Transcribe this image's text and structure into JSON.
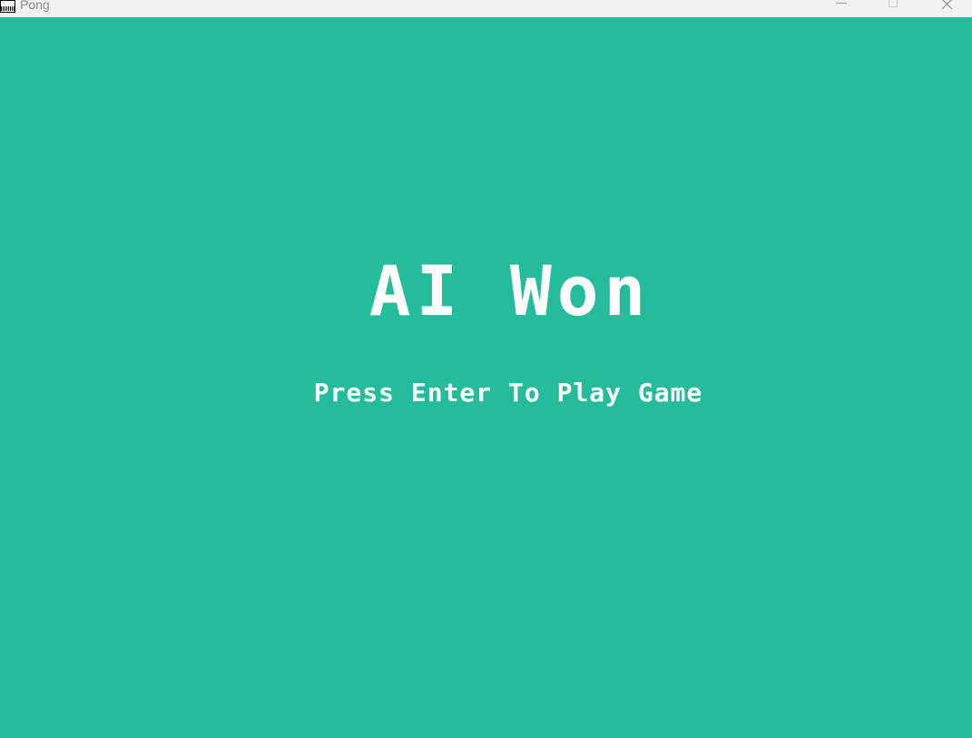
{
  "window": {
    "title": "Pong",
    "app_icon": "pygame-icon",
    "controls": {
      "minimize_icon": "minimize-icon",
      "maximize_icon": "maximize-icon",
      "close_icon": "close-icon"
    }
  },
  "game": {
    "background_color": "#25bc9c",
    "text_color": "#ffffff",
    "winner_message": "AI Won",
    "prompt_message": "Press Enter To Play Game"
  }
}
